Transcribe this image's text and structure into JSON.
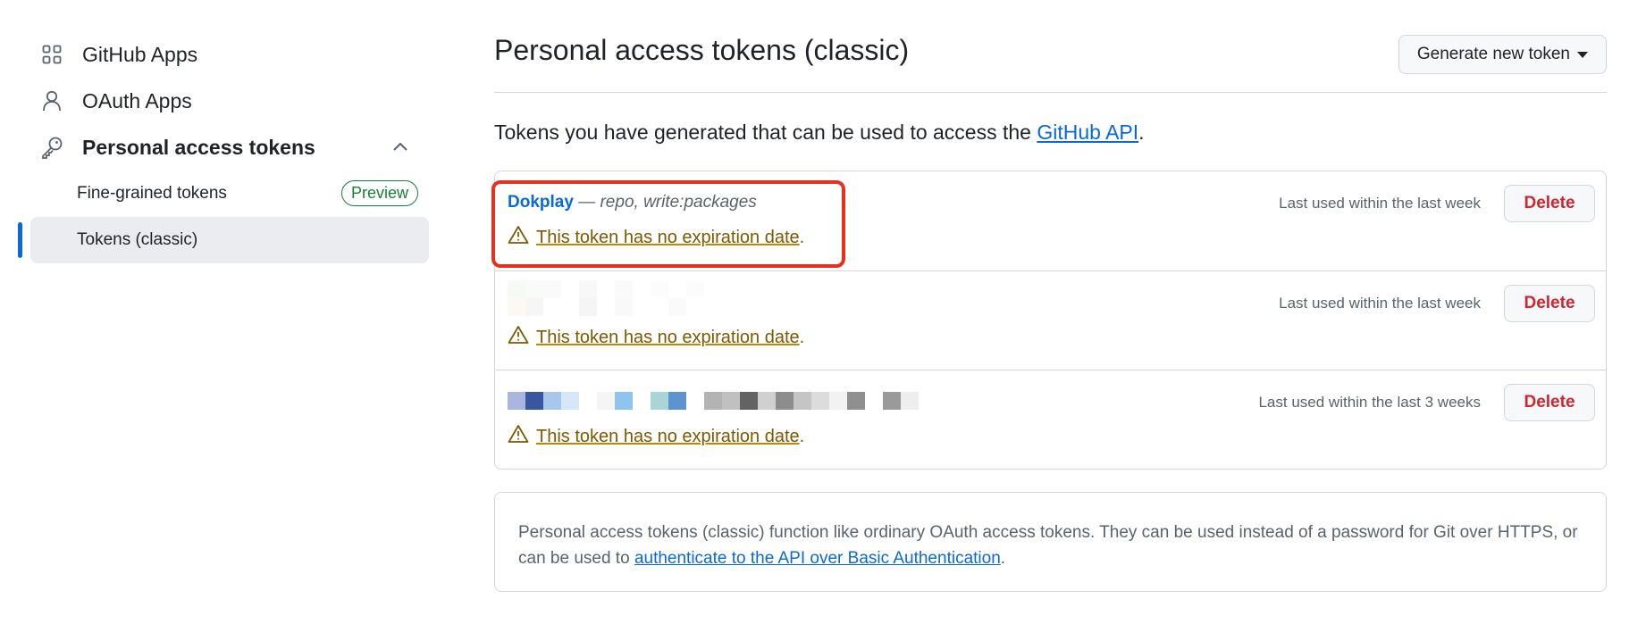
{
  "sidebar": {
    "items": [
      {
        "label": "GitHub Apps",
        "icon": "apps-grid-icon"
      },
      {
        "label": "OAuth Apps",
        "icon": "person-icon"
      },
      {
        "label": "Personal access tokens",
        "icon": "key-icon"
      }
    ],
    "subitems": [
      {
        "label": "Fine-grained tokens",
        "badge": "Preview"
      },
      {
        "label": "Tokens (classic)"
      }
    ]
  },
  "main": {
    "title": "Personal access tokens (classic)",
    "generate_button": "Generate new token",
    "intro_text": "Tokens you have generated that can be used to access the ",
    "intro_link": "GitHub API",
    "intro_end": ".",
    "tokens": [
      {
        "name": "Dokplay",
        "separator": " — ",
        "scopes": "repo, write:packages",
        "last_used": "Last used within the last week",
        "warning": "This token has no expiration date",
        "delete": "Delete"
      },
      {
        "name": "",
        "scopes": "",
        "last_used": "Last used within the last week",
        "warning": "This token has no expiration date",
        "delete": "Delete"
      },
      {
        "name": "",
        "scopes": "",
        "last_used": "Last used within the last 3 weeks",
        "warning": "This token has no expiration date",
        "delete": "Delete"
      }
    ],
    "info": {
      "text": "Personal access tokens (classic) function like ordinary OAuth access tokens. They can be used instead of a password for Git over HTTPS, or can be used to ",
      "link": "authenticate to the API over Basic Authentication",
      "end": "."
    }
  },
  "colors": {
    "accent": "#0969da",
    "danger": "#d1242f",
    "warning": "#7d5900",
    "success": "#1a7f37",
    "highlight": "#e5311f"
  }
}
